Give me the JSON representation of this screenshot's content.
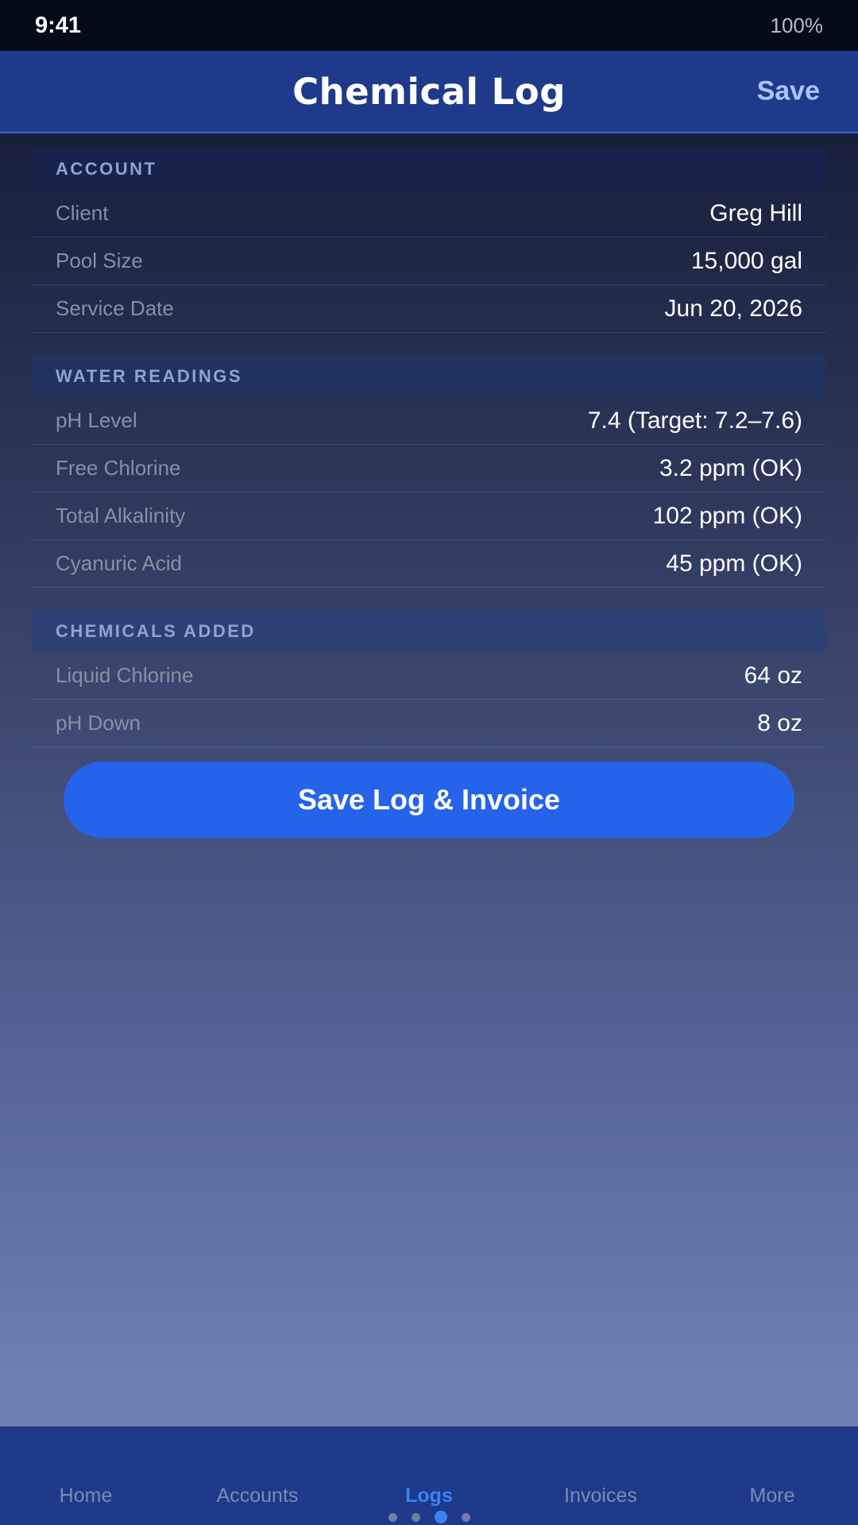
{
  "status_bar": {
    "time": "9:41",
    "battery": "100%"
  },
  "header": {
    "title": "Chemical Log",
    "save_label": "Save"
  },
  "sections": {
    "account": {
      "title": "ACCOUNT",
      "rows": [
        {
          "label": "Client",
          "value": "Greg Hill"
        },
        {
          "label": "Pool Size",
          "value": "15,000 gal"
        },
        {
          "label": "Service Date",
          "value": "Jun 20, 2026"
        }
      ]
    },
    "water_readings": {
      "title": "WATER READINGS",
      "rows": [
        {
          "label": "pH Level",
          "value": "7.4 (Target: 7.2–7.6)"
        },
        {
          "label": "Free Chlorine",
          "value": "3.2 ppm (OK)"
        },
        {
          "label": "Total Alkalinity",
          "value": "102 ppm (OK)"
        },
        {
          "label": "Cyanuric Acid",
          "value": "45 ppm (OK)"
        }
      ]
    },
    "chemicals_added": {
      "title": "CHEMICALS ADDED",
      "rows": [
        {
          "label": "Liquid Chlorine",
          "value": "64 oz"
        },
        {
          "label": "pH Down",
          "value": "8 oz"
        }
      ]
    }
  },
  "primary_action": {
    "label": "Save Log & Invoice"
  },
  "tab_bar": {
    "active_index": 2,
    "items": [
      {
        "label": "Home"
      },
      {
        "label": "Accounts"
      },
      {
        "label": "Logs"
      },
      {
        "label": "Invoices"
      },
      {
        "label": "More"
      }
    ]
  },
  "pager": {
    "count": 4,
    "active_index": 2
  },
  "colors": {
    "accent": "#2563eb",
    "nav_bar": "#1f3a8a",
    "status_bar": "#050a18",
    "save_text": "#a9c4ff",
    "active_tab": "#3b82f6"
  }
}
